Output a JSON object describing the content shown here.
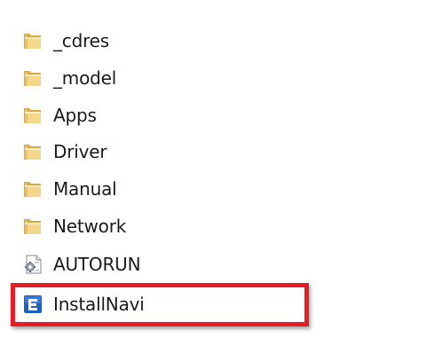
{
  "files": [
    {
      "name": "_cdres",
      "type": "folder",
      "icon": "folder-icon"
    },
    {
      "name": "_model",
      "type": "folder",
      "icon": "folder-icon"
    },
    {
      "name": "Apps",
      "type": "folder",
      "icon": "folder-icon"
    },
    {
      "name": "Driver",
      "type": "folder",
      "icon": "folder-icon"
    },
    {
      "name": "Manual",
      "type": "folder",
      "icon": "folder-icon"
    },
    {
      "name": "Network",
      "type": "folder",
      "icon": "folder-icon"
    },
    {
      "name": "AUTORUN",
      "type": "setup-info",
      "icon": "setup-info-file-icon"
    },
    {
      "name": "InstallNavi",
      "type": "application",
      "icon": "installnavi-app-icon"
    }
  ],
  "colors": {
    "highlight": "#e61e24",
    "folder_light": "#f6e2a0",
    "folder_dark": "#d9a93d",
    "app_blue": "#1f5fbf"
  }
}
